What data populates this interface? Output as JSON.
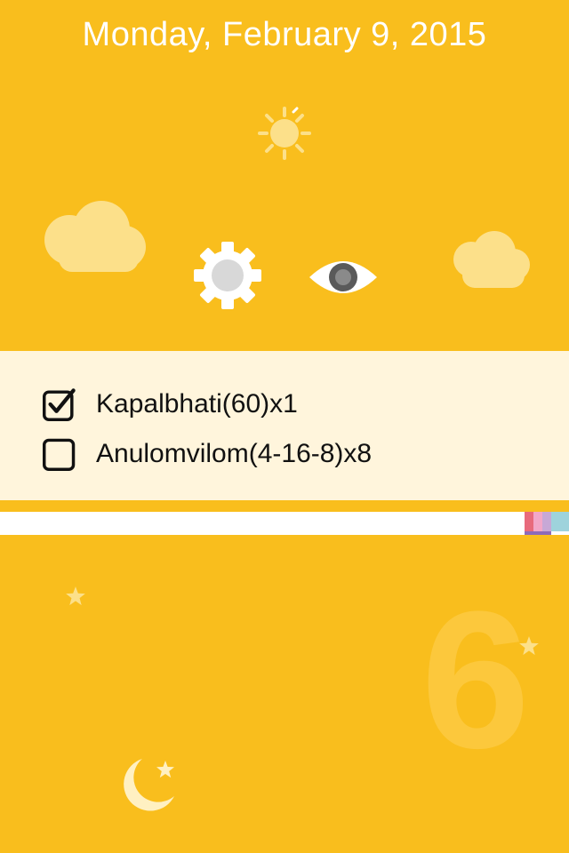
{
  "header": {
    "date": "Monday, February 9, 2015"
  },
  "icons": {
    "sun": "sun-icon",
    "cloud_left": "cloud-icon",
    "cloud_right": "cloud-icon",
    "settings": "gear-icon",
    "view": "eye-icon",
    "moon": "moon-star-icon",
    "star": "star-icon"
  },
  "tasks": [
    {
      "label": "Kapalbhati(60)x1",
      "checked": true
    },
    {
      "label": "Anulomvilom(4-16-8)x8",
      "checked": false
    }
  ],
  "day_number": "6",
  "colors": {
    "background": "#F9BE1D",
    "panel": "#FFF5DC",
    "cloud": "#FCE08A",
    "palette": [
      "#E86A7C",
      "#8E6BB8",
      "#F2A7C8",
      "#9ED3DC"
    ]
  }
}
